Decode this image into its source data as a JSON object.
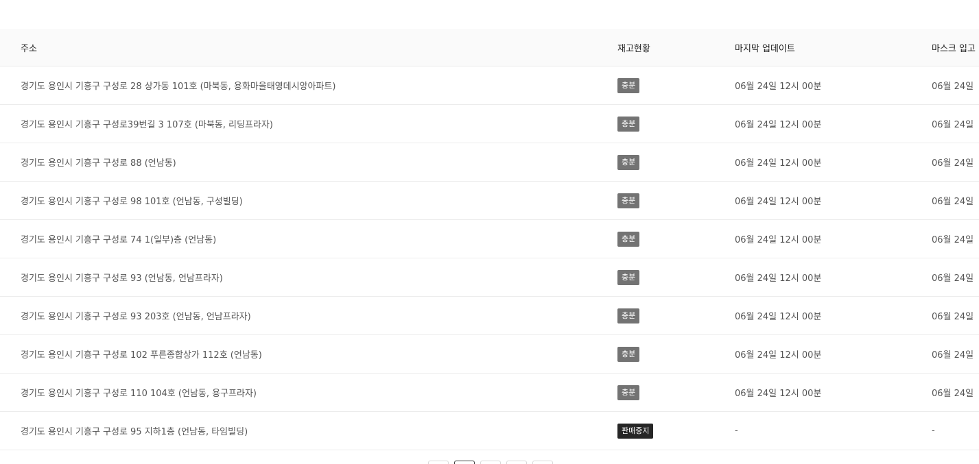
{
  "table": {
    "headers": {
      "address": "주소",
      "stock": "재고현황",
      "last_update": "마지막 업데이트",
      "mask_in": "마스크 입고"
    },
    "rows": [
      {
        "address": "경기도 용인시 기흥구 구성로 28 상가동 101호 (마북동, 용화마을태영데시앙아파트)",
        "stock": "충분",
        "stock_level": "plenty",
        "last_update": "06월 24일 12시 00분",
        "mask_in": "06월 24일"
      },
      {
        "address": "경기도 용인시 기흥구 구성로39번길 3 107호 (마북동, 리딩프라자)",
        "stock": "충분",
        "stock_level": "plenty",
        "last_update": "06월 24일 12시 00분",
        "mask_in": "06월 24일"
      },
      {
        "address": "경기도 용인시 기흥구 구성로 88 (언남동)",
        "stock": "충분",
        "stock_level": "plenty",
        "last_update": "06월 24일 12시 00분",
        "mask_in": "06월 24일"
      },
      {
        "address": "경기도 용인시 기흥구 구성로 98 101호 (언남동, 구성빌딩)",
        "stock": "충분",
        "stock_level": "plenty",
        "last_update": "06월 24일 12시 00분",
        "mask_in": "06월 24일"
      },
      {
        "address": "경기도 용인시 기흥구 구성로 74 1(일부)층 (언남동)",
        "stock": "충분",
        "stock_level": "plenty",
        "last_update": "06월 24일 12시 00분",
        "mask_in": "06월 24일"
      },
      {
        "address": "경기도 용인시 기흥구 구성로 93 (언남동, 언남프라자)",
        "stock": "충분",
        "stock_level": "plenty",
        "last_update": "06월 24일 12시 00분",
        "mask_in": "06월 24일"
      },
      {
        "address": "경기도 용인시 기흥구 구성로 93 203호 (언남동, 언남프라자)",
        "stock": "충분",
        "stock_level": "plenty",
        "last_update": "06월 24일 12시 00분",
        "mask_in": "06월 24일"
      },
      {
        "address": "경기도 용인시 기흥구 구성로 102 푸른종합상가 112호 (언남동)",
        "stock": "충분",
        "stock_level": "plenty",
        "last_update": "06월 24일 12시 00분",
        "mask_in": "06월 24일"
      },
      {
        "address": "경기도 용인시 기흥구 구성로 110 104호 (언남동, 용구프라자)",
        "stock": "충분",
        "stock_level": "plenty",
        "last_update": "06월 24일 12시 00분",
        "mask_in": "06월 24일"
      },
      {
        "address": "경기도 용인시 기흥구 구성로 95 지하1층 (언남동, 타임빌딩)",
        "stock": "판매중지",
        "stock_level": "stopped",
        "last_update": "-",
        "mask_in": "-"
      }
    ]
  },
  "colors": {
    "badge_plenty": "#737373",
    "badge_stopped": "#262626",
    "header_bg": "#fafafa",
    "row_border": "#ececec"
  },
  "pagination": {
    "active_index": 1
  }
}
